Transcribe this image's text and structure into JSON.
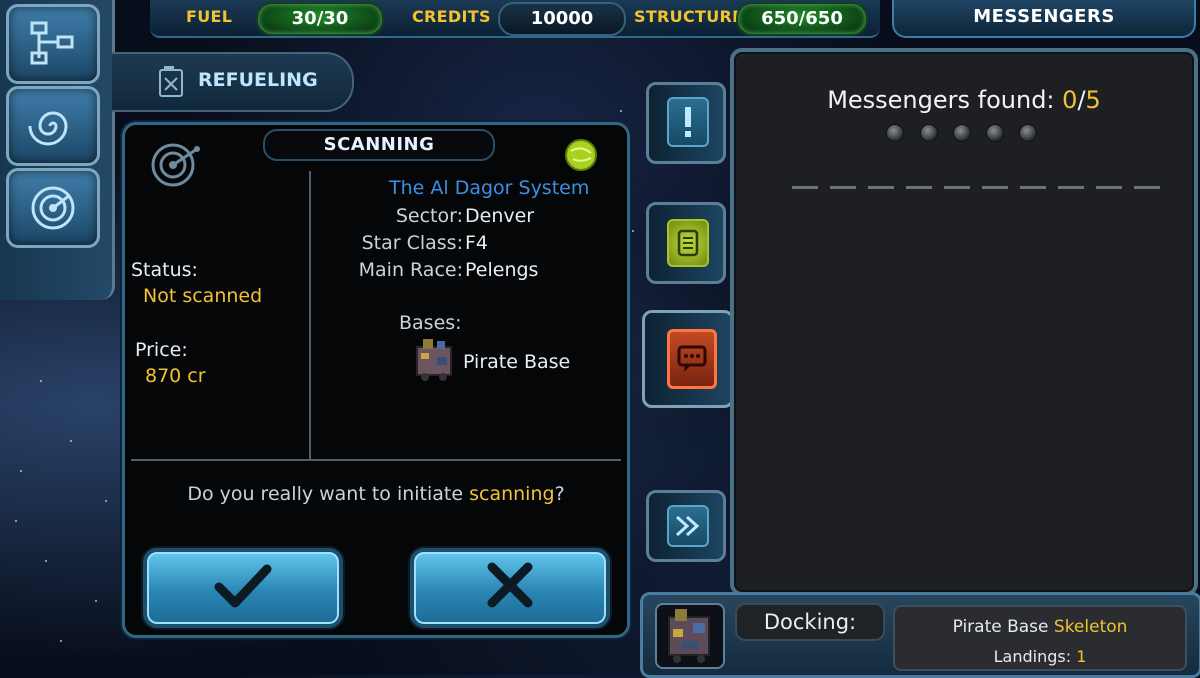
{
  "topbar": {
    "fuel_label": "FUEL",
    "fuel_value": "30/30",
    "credits_label": "CREDITS",
    "credits_value": "10000",
    "structure_label": "STRUCTURE",
    "structure_value": "650/650",
    "messengers_tab": "MESSENGERS"
  },
  "leftnav": {
    "items": [
      {
        "icon": "network-map-icon"
      },
      {
        "icon": "spiral-galaxy-icon"
      },
      {
        "icon": "radar-icon"
      }
    ],
    "refueling_label": "REFUELING",
    "refueling_icon": "fuel-can-icon"
  },
  "dialog": {
    "title": "SCANNING",
    "status_label": "Status:",
    "status_value": "Not scanned",
    "price_label": "Price:",
    "price_value": "870 cr",
    "system_name": "The Al Dagor System",
    "sector_label": "Sector:",
    "sector_value": "Denver",
    "star_class_label": "Star Class:",
    "star_class_value": "F4",
    "main_race_label": "Main Race:",
    "main_race_value": "Pelengs",
    "bases_label": "Bases:",
    "base_name": "Pirate Base",
    "question_prefix": "Do you really want to initiate ",
    "question_highlight": "scanning",
    "question_suffix": "?",
    "confirm_icon": "checkmark-icon",
    "cancel_icon": "cross-icon"
  },
  "messengers": {
    "found_label": "Messengers found: ",
    "found_count": "0",
    "separator": "/",
    "total": "5"
  },
  "docking": {
    "label": "Docking:",
    "base_prefix": "Pirate Base ",
    "base_name": "Skeleton",
    "landings_label": "Landings: ",
    "landings_value": "1"
  },
  "colors": {
    "accent_yellow": "#f1c232",
    "system_blue": "#3e8fe0",
    "pill_green": "#1f8a2c"
  }
}
